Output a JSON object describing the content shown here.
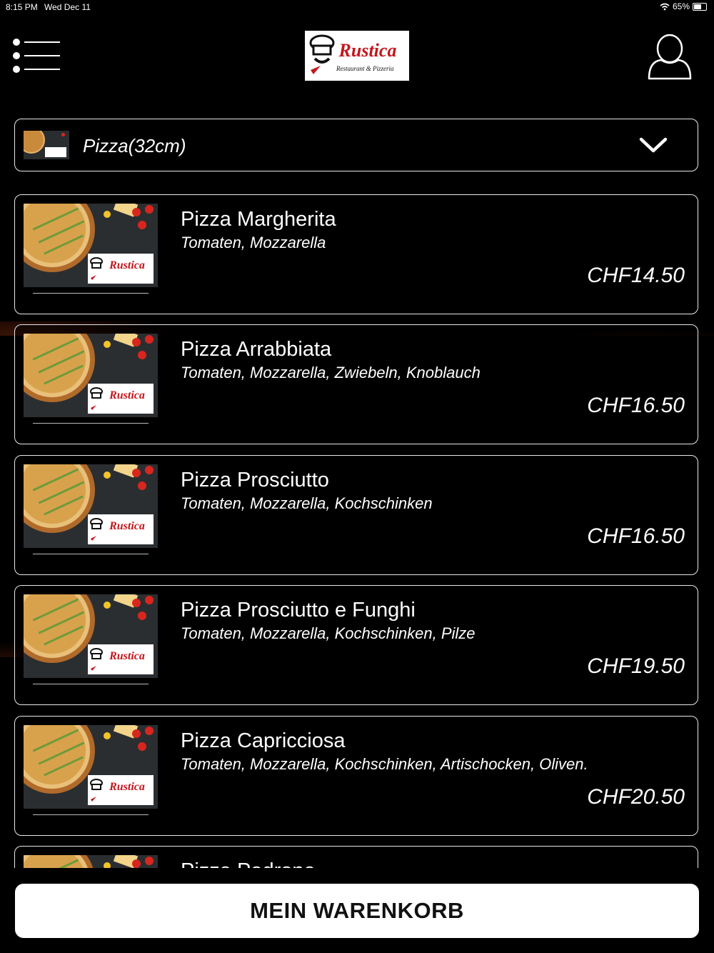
{
  "status_bar": {
    "time": "8:15 PM",
    "date": "Wed Dec 11",
    "battery": "65%"
  },
  "header": {
    "logo_name": "Rustica",
    "logo_tagline": "Restaurant & Pizzeria"
  },
  "category": {
    "label": "Pizza(32cm)"
  },
  "items": [
    {
      "name": "Pizza Margherita",
      "desc": "Tomaten, Mozzarella",
      "price": "CHF14.50"
    },
    {
      "name": "Pizza Arrabbiata",
      "desc": "Tomaten, Mozzarella, Zwiebeln, Knoblauch",
      "price": "CHF16.50"
    },
    {
      "name": "Pizza Prosciutto",
      "desc": "Tomaten, Mozzarella, Kochschinken",
      "price": "CHF16.50"
    },
    {
      "name": "Pizza Prosciutto e Funghi",
      "desc": "Tomaten, Mozzarella, Kochschinken, Pilze",
      "price": "CHF19.50"
    },
    {
      "name": "Pizza Capricciosa",
      "desc": "Tomaten, Mozzarella, Kochschinken, Artischocken, Oliven.",
      "price": "CHF20.50"
    },
    {
      "name": "Pizza Padrone",
      "desc": "",
      "price": ""
    }
  ],
  "cart": {
    "label": "MEIN WARENKORB"
  }
}
